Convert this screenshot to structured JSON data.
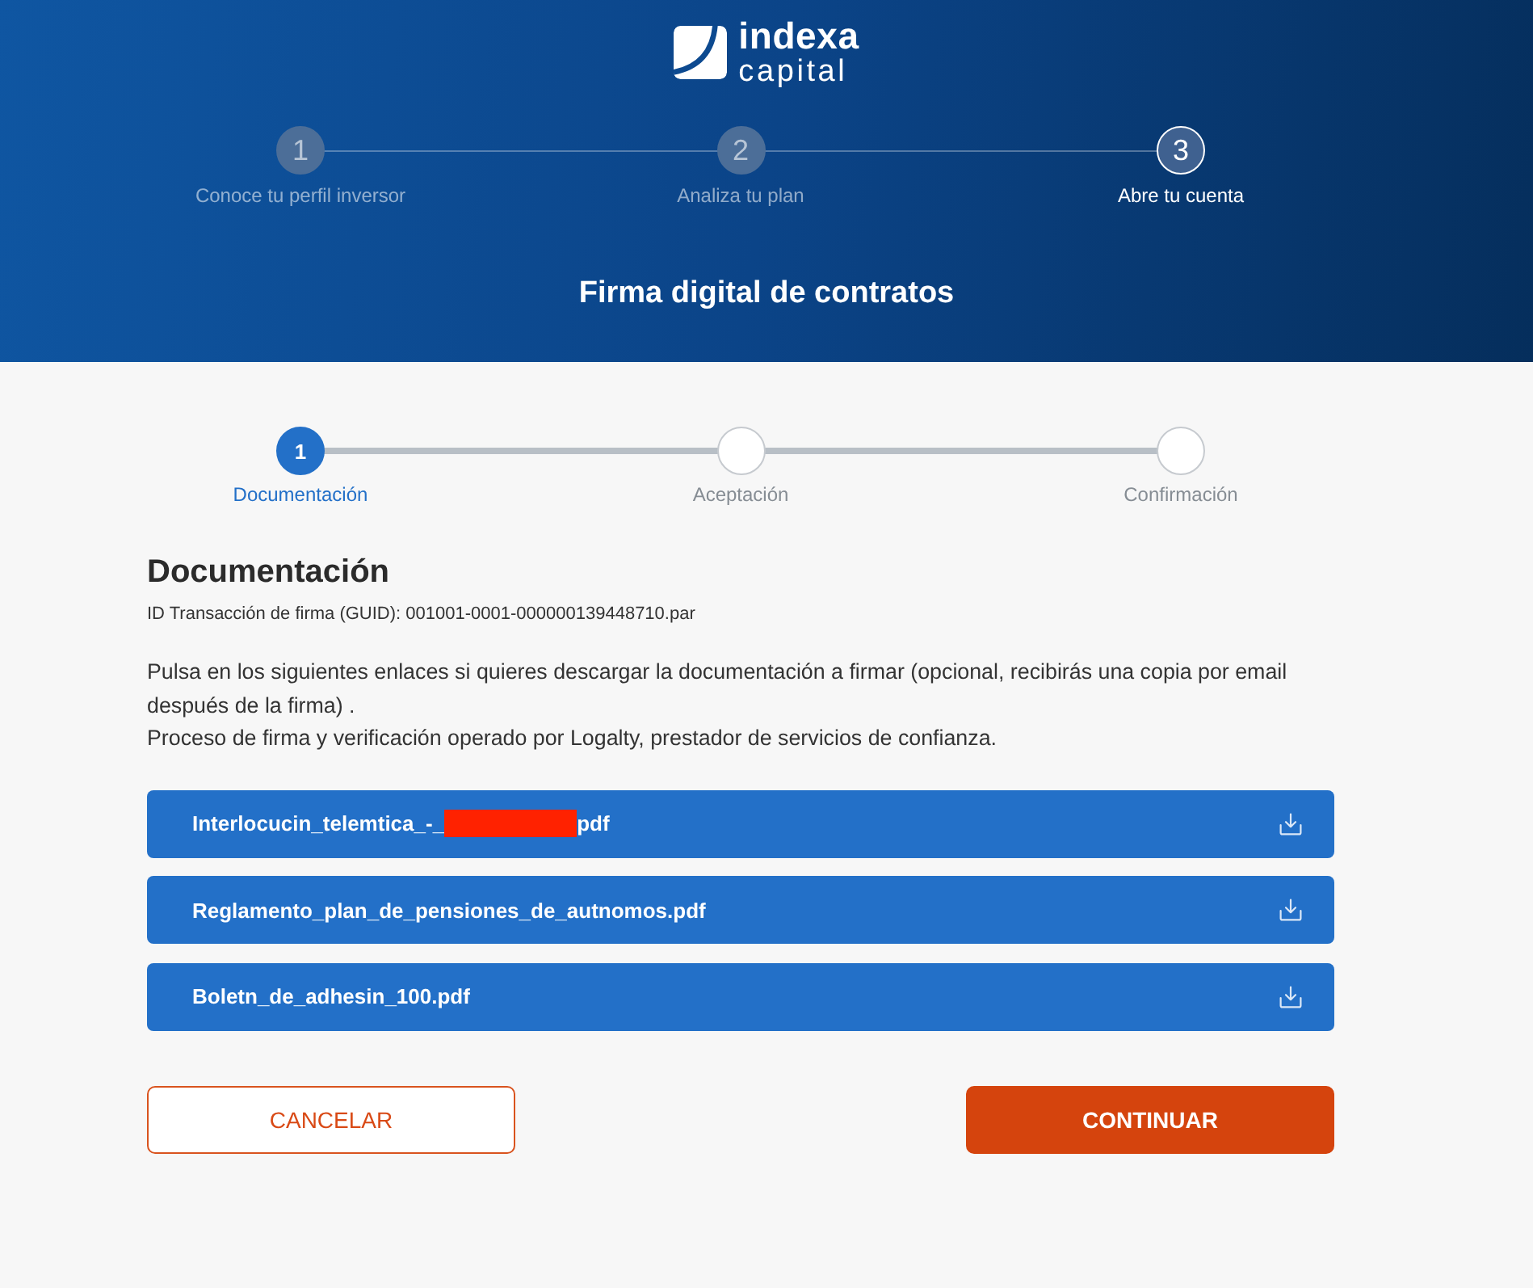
{
  "header": {
    "logo": {
      "name": "indexa",
      "subname": "capital"
    },
    "steps": [
      {
        "number": "1",
        "label": "Conoce tu perfil inversor",
        "selected": false
      },
      {
        "number": "2",
        "label": "Analiza tu plan",
        "selected": false
      },
      {
        "number": "3",
        "label": "Abre tu cuenta",
        "selected": true
      }
    ],
    "title": "Firma digital de contratos"
  },
  "signing_steps": [
    {
      "number": "1",
      "label": "Documentación",
      "selected": true
    },
    {
      "label": "Aceptación",
      "selected": false
    },
    {
      "label": "Confirmación",
      "selected": false
    }
  ],
  "section": {
    "title": "Documentación",
    "transaction_id": "ID Transacción de firma (GUID): 001001-0001-000000139448710.par",
    "paragraphs": [
      "Pulsa en los siguientes enlaces si quieres descargar la documentación a firmar (opcional, recibirás una copia por email después de la firma) .",
      "Proceso de firma y verificación operado por Logalty, prestador de servicios de confianza."
    ]
  },
  "documents": [
    {
      "name": "Interlocucin_telemtica_-_",
      "redacted": true,
      "name_end": "pdf"
    },
    {
      "name": "Reglamento_plan_de_pensiones_de_autnomos.pdf",
      "redacted": false
    },
    {
      "name": "Boletn_de_adhesin_100.pdf",
      "redacted": false
    }
  ],
  "buttons": [
    {
      "label": "CANCELAR",
      "kind": "secondary"
    },
    {
      "label": "CONTINUAR",
      "kind": "primary"
    }
  ]
}
